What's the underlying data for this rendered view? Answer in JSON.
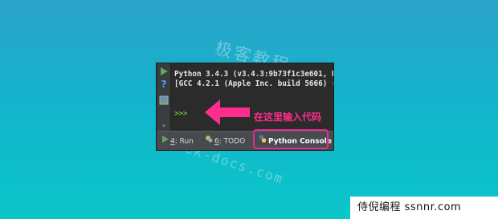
{
  "watermark": {
    "cn": "极客教程",
    "en": "geek-docs.com"
  },
  "console": {
    "line1": "Python 3.4.3 (v3.4.3:9b73f1c3e601, F",
    "line2": "[GCC 4.2.1 (Apple Inc. build 5666) (",
    "prompt": ">>>"
  },
  "gutter_icons": [
    "play-icon",
    "help-icon",
    "image-icon",
    "more-icon"
  ],
  "bottom_tabs": {
    "run_num": "4",
    "run_label": ": Run",
    "todo_num": "6",
    "todo_label": ": TODO",
    "console_label": "Python Console"
  },
  "annotation": "在这里输入代码",
  "footer": "侍倪编程 ssnnr.com",
  "colors": {
    "accent_pink": "#e8288f",
    "prompt_green": "#6fcf2f",
    "run_green": "#59a869"
  }
}
